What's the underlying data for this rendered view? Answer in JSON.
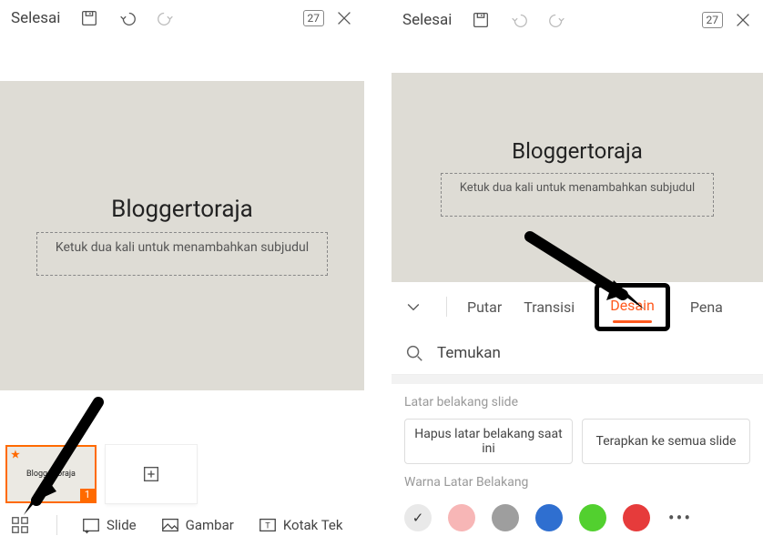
{
  "topbar": {
    "done_label": "Selesai",
    "page_count": "27"
  },
  "slide": {
    "title": "Bloggertoraja",
    "subtitle_placeholder": "Ketuk dua kali untuk menambahkan subjudul"
  },
  "thumbnail": {
    "title": "Bloggertoraja",
    "slide_number": "1"
  },
  "bottom_tools": {
    "slide": "Slide",
    "gambar": "Gambar",
    "kotak": "Kotak Tek"
  },
  "tabs": {
    "putar": "Putar",
    "transisi": "Transisi",
    "desain": "Desain",
    "pena": "Pena"
  },
  "search": {
    "label": "Temukan"
  },
  "design_panel": {
    "section1_title": "Latar belakang slide",
    "btn_remove": "Hapus latar belakang saat ini",
    "btn_apply_all": "Terapkan ke semua slide",
    "section2_title": "Warna Latar Belakang",
    "colors": [
      {
        "value": "#e9e9e9",
        "selected": true
      },
      {
        "value": "#f7b6b6",
        "selected": false
      },
      {
        "value": "#9e9e9e",
        "selected": false
      },
      {
        "value": "#2f6fd0",
        "selected": false
      },
      {
        "value": "#52d02f",
        "selected": false
      },
      {
        "value": "#e63b3b",
        "selected": false
      }
    ]
  }
}
